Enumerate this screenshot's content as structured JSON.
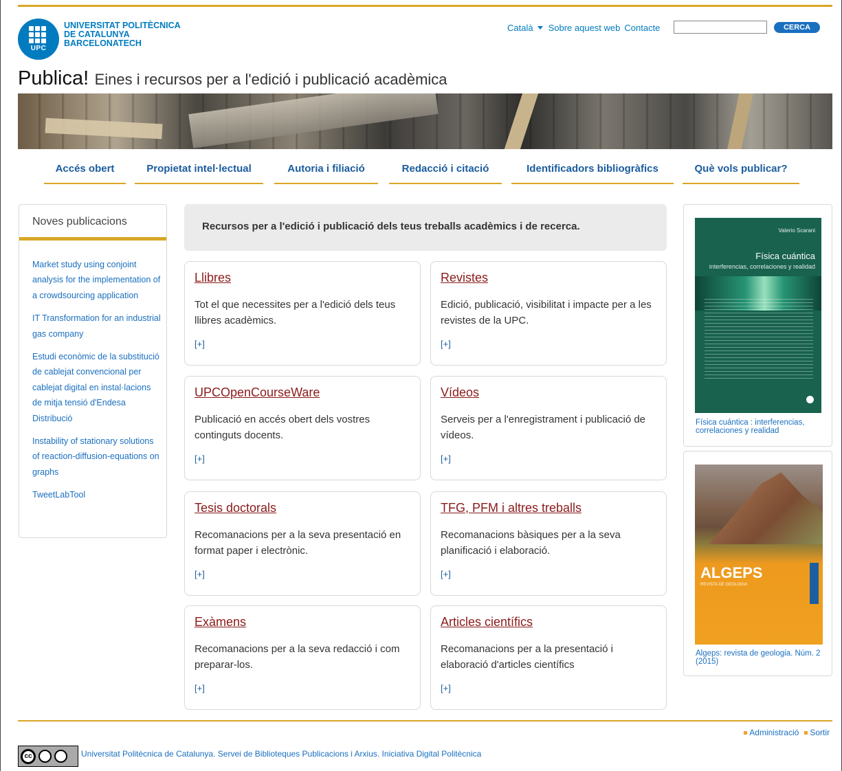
{
  "header": {
    "logo_text": "UNIVERSITAT POLITÈCNICA\nDE CATALUNYA\nBARCELONATECH",
    "logo_abbrev": "UPC",
    "language": "Català",
    "links": {
      "about": "Sobre aquest web",
      "contact": "Contacte"
    },
    "search": {
      "value": "",
      "button": "CERCA"
    }
  },
  "site": {
    "title": "Publica!",
    "subtitle": "Eines i recursos per a l'edició i publicació acadèmica"
  },
  "nav": [
    {
      "label": "Accés obert"
    },
    {
      "label": "Propietat intel·lectual"
    },
    {
      "label": "Autoria i filiació"
    },
    {
      "label": "Redacció i citació"
    },
    {
      "label": "Identificadors bibliogràfics"
    },
    {
      "label": "Què vols publicar?"
    }
  ],
  "sidebar": {
    "title": "Noves publicacions",
    "items": [
      {
        "label": "Market study using conjoint analysis for the implementation of a crowdsourcing application"
      },
      {
        "label": "IT Transformation for an industrial gas company"
      },
      {
        "label": "Estudi econòmic de la substitució de cablejat convencional per cablejat digital en instal·lacions de mitja tensió d'Endesa Distribució"
      },
      {
        "label": "Instability of stationary solutions of reaction-diffusion-equations on graphs"
      },
      {
        "label": "TweetLabTool"
      }
    ]
  },
  "intro": "Recursos per a l'edició i publicació dels teus treballs acadèmics i de recerca.",
  "cards": [
    {
      "title": "Llibres",
      "desc": "Tot el que necessites per a l'edició dels teus llibres acadèmics.",
      "more": "[+]"
    },
    {
      "title": "Revistes",
      "desc": "Edició, publicació, visibilitat i impacte per a les revistes de la UPC.",
      "more": "[+]"
    },
    {
      "title": "UPCOpenCourseWare",
      "desc": "Publicació en accés obert dels vostres continguts docents.",
      "more": "[+]"
    },
    {
      "title": "Vídeos",
      "desc": "Serveis per a l'enregistrament i publicació de vídeos.",
      "more": "[+]"
    },
    {
      "title": "Tesis doctorals",
      "desc": "Recomanacions per a la seva presentació en format paper i electrònic.",
      "more": "[+]"
    },
    {
      "title": "TFG, PFM i altres treballs",
      "desc": "Recomanacions bàsiques per a la seva planificació i elaboració.",
      "more": "[+]"
    },
    {
      "title": "Exàmens",
      "desc": "Recomanacions per a la seva redacció i com preparar-los.",
      "more": "[+]"
    },
    {
      "title": "Articles científics",
      "desc": "Recomanacions per a la presentació i elaboració d'articles científics",
      "more": "[+]"
    }
  ],
  "books": [
    {
      "author": "Valerio Scarani",
      "cover_title": "Física cuántica",
      "cover_subtitle": "interferencias, correlaciones y realidad",
      "link": "Física cuántica : interferencias, correlaciones y realidad"
    },
    {
      "cover_title": "ALGEPS",
      "cover_subtitle": "REVISTA DE GEOLOGIA",
      "link": "Algeps: revista de geologia. Núm. 2 (2015)"
    }
  ],
  "footer": {
    "admin": "Administració",
    "logout": "Sortir",
    "license": "cc",
    "text": "Universitat Politècnica de Catalunya. Servei de Biblioteques Publicacions i Arxius. Iniciativa Digital Politècnica"
  },
  "colors": {
    "accent": "#d8a626",
    "link": "#1a6fbf",
    "card_title": "#8b1a1a",
    "brand": "#007bc0"
  }
}
